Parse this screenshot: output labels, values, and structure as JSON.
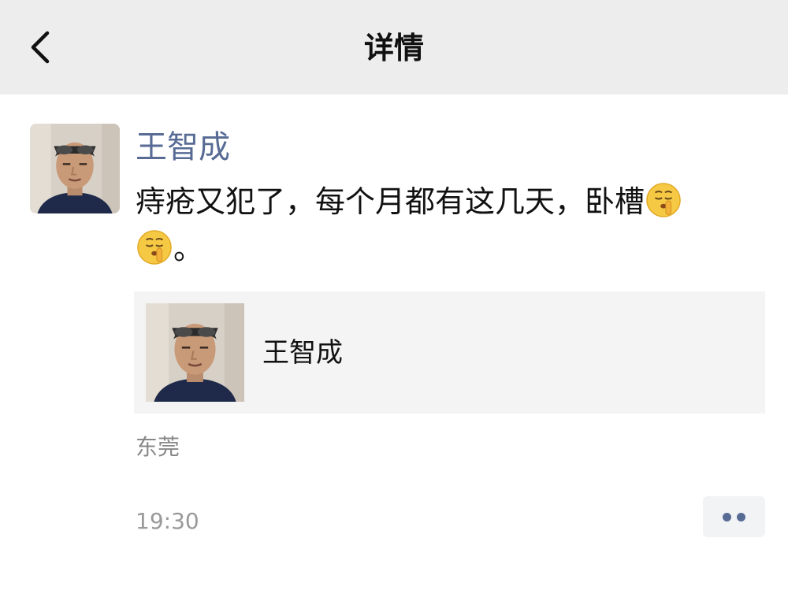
{
  "header": {
    "title": "详情",
    "back_icon": "chevron-left-icon"
  },
  "post": {
    "author": "王智成",
    "text_part1": "痔疮又犯了，每个月都有这几天，卧槽",
    "text_part2": "。",
    "emojis": [
      "shushing-face-emoji",
      "shushing-face-emoji"
    ],
    "shared_card": {
      "title": "王智成"
    },
    "location": "东莞",
    "time": "19:30",
    "more_icon": "more-dots-icon"
  },
  "colors": {
    "header_bg": "#ededed",
    "author_name": "#576b95",
    "card_bg": "#f4f4f4",
    "muted_text": "#888888"
  }
}
